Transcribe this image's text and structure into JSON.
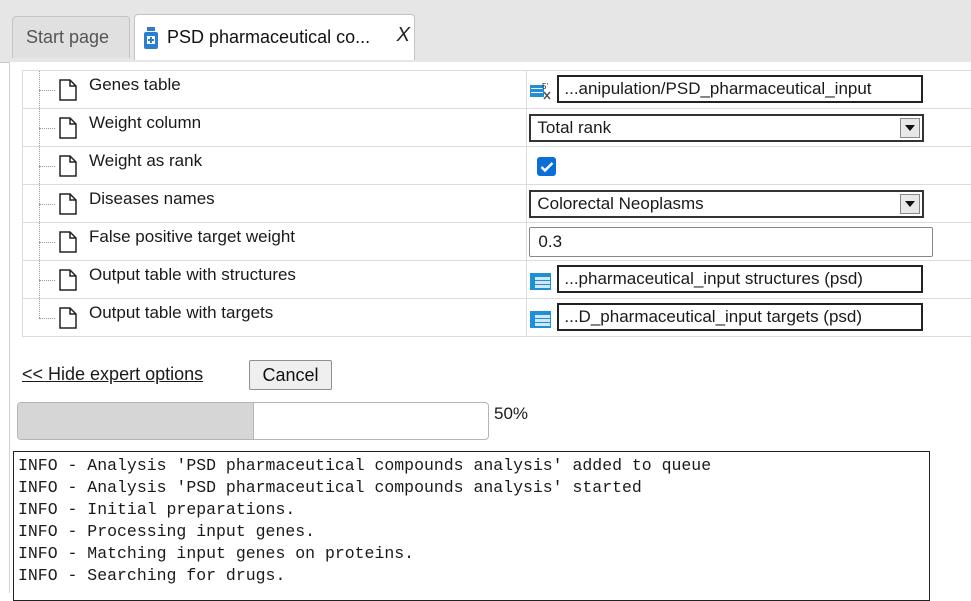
{
  "tabs": [
    {
      "label": "Start page"
    },
    {
      "label": "PSD pharmaceutical co...",
      "close": "X"
    }
  ],
  "properties": [
    {
      "name": "Genes table",
      "value": "...anipulation/PSD_pharmaceutical_input",
      "type": "table-ref",
      "icon": "gene-table-icon"
    },
    {
      "name": "Weight column",
      "value": "Total rank",
      "type": "select"
    },
    {
      "name": "Weight as rank",
      "value": true,
      "type": "checkbox"
    },
    {
      "name": "Diseases names",
      "value": "Colorectal Neoplasms",
      "type": "select"
    },
    {
      "name": "False positive target weight",
      "value": "0.3",
      "type": "text"
    },
    {
      "name": "Output table with structures",
      "value": "...pharmaceutical_input structures (psd)",
      "type": "table-ref",
      "icon": "table-icon"
    },
    {
      "name": "Output table with targets",
      "value": "...D_pharmaceutical_input targets (psd)",
      "type": "table-ref",
      "icon": "table-icon"
    }
  ],
  "actions": {
    "hide_expert": "<< Hide expert options",
    "cancel": "Cancel"
  },
  "progress": {
    "percent": 50,
    "label": "50%"
  },
  "log": [
    "INFO - Analysis 'PSD pharmaceutical compounds analysis' added to queue",
    "INFO - Analysis 'PSD pharmaceutical compounds analysis' started",
    "INFO - Initial preparations.",
    "INFO - Processing input genes.",
    "INFO - Matching input genes on proteins.",
    "INFO - Searching for drugs."
  ],
  "colors": {
    "checkbox": "#0a6fd6",
    "table_icon": "#1f8fd8",
    "progress_fill": "#d6d6d6"
  }
}
